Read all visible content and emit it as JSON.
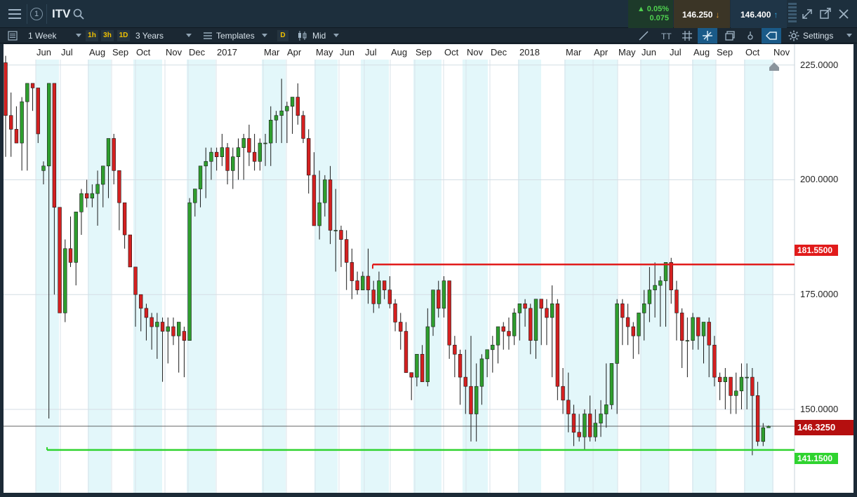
{
  "header": {
    "symbol": "ITV",
    "chart_number": "1",
    "change_pct": "0.05%",
    "change_abs": "0.075",
    "sell_price": "146.250",
    "buy_price": "146.400"
  },
  "toolbar": {
    "interval": "1 Week",
    "quick_intervals": [
      "1h",
      "3h",
      "1D"
    ],
    "range": "3 Years",
    "templates": "Templates",
    "price_type_chip": "D",
    "price_type": "Mid",
    "settings": "Settings"
  },
  "chart_data": {
    "type": "candlestick",
    "instrument": "ITV",
    "interval": "1 Week",
    "x_labels": [
      "Jun",
      "Jul",
      "Aug",
      "Sep",
      "Oct",
      "Nov",
      "Dec",
      "2017",
      "Mar",
      "Apr",
      "May",
      "Jun",
      "Jul",
      "Aug",
      "Sep",
      "Oct",
      "Nov",
      "Dec",
      "2018",
      "Mar",
      "Apr",
      "May",
      "Jun",
      "Jul",
      "Aug",
      "Sep",
      "Oct",
      "Nov"
    ],
    "y_ticks": [
      "225.0000",
      "200.0000",
      "175.0000",
      "150.0000"
    ],
    "ylim": [
      136.5,
      228
    ],
    "current_price": "146.3250",
    "horizontal_lines": [
      {
        "label": "181.5500",
        "value": 181.55,
        "color": "#e11b1b"
      },
      {
        "label": "141.1500",
        "value": 141.15,
        "color": "#2fd32f"
      }
    ],
    "colors": {
      "up": "#2e9e2e",
      "down": "#d42020",
      "band": "#e3f7fa"
    },
    "candles": [
      [
        225.5,
        227,
        205,
        214
      ],
      [
        214,
        219,
        205,
        211
      ],
      [
        211,
        216,
        208,
        208
      ],
      [
        208,
        218,
        202,
        217
      ],
      [
        217,
        221,
        202,
        221
      ],
      [
        221,
        221,
        215,
        220
      ],
      [
        220,
        220,
        208,
        210
      ],
      [
        202,
        204,
        199,
        203
      ],
      [
        203,
        220,
        148,
        221
      ],
      [
        221,
        221,
        175,
        194
      ],
      [
        194,
        194,
        171,
        171
      ],
      [
        171,
        187,
        169,
        185
      ],
      [
        185,
        192,
        181,
        182
      ],
      [
        182,
        193,
        177,
        193
      ],
      [
        193,
        198,
        188,
        197
      ],
      [
        197,
        200,
        194,
        196
      ],
      [
        196,
        199,
        194,
        197
      ],
      [
        197,
        202,
        190,
        199
      ],
      [
        199,
        202,
        194,
        203
      ],
      [
        203,
        202,
        196,
        209
      ],
      [
        209,
        210,
        199,
        202
      ],
      [
        202,
        202,
        189,
        195
      ],
      [
        195,
        194,
        185,
        188
      ],
      [
        188,
        186,
        182,
        181
      ],
      [
        181,
        180,
        168,
        175
      ],
      [
        175,
        173,
        167,
        172
      ],
      [
        172,
        173,
        165,
        170
      ],
      [
        170,
        171,
        163,
        168
      ],
      [
        168,
        171,
        161,
        169
      ],
      [
        169,
        170,
        156,
        167
      ],
      [
        167,
        170,
        160,
        168
      ],
      [
        168,
        170,
        164,
        166
      ],
      [
        166,
        169,
        158,
        169
      ],
      [
        167,
        168,
        157,
        165
      ],
      [
        165,
        196,
        165,
        195
      ],
      [
        195,
        197,
        192,
        198
      ],
      [
        198,
        202,
        194,
        203
      ],
      [
        203,
        207,
        196,
        204
      ],
      [
        204,
        207,
        200,
        206
      ],
      [
        206,
        207,
        202,
        205
      ],
      [
        205,
        210,
        203,
        207
      ],
      [
        207,
        208,
        199,
        202
      ],
      [
        202,
        207,
        198,
        205
      ],
      [
        205,
        209,
        200,
        207
      ],
      [
        207,
        210,
        200,
        209
      ],
      [
        209,
        212,
        203,
        206
      ],
      [
        206,
        210,
        202,
        204
      ],
      [
        204,
        209,
        202,
        208
      ],
      [
        208,
        210,
        203,
        208
      ],
      [
        208,
        216,
        203,
        213
      ],
      [
        213,
        215,
        208,
        214
      ],
      [
        214,
        222,
        208,
        215
      ],
      [
        215,
        217,
        208,
        216
      ],
      [
        216,
        217,
        210,
        218
      ],
      [
        218,
        221,
        212,
        214
      ],
      [
        214,
        215,
        208,
        209
      ],
      [
        209,
        211,
        197,
        201
      ],
      [
        201,
        206,
        192,
        190
      ],
      [
        190,
        202,
        187,
        195
      ],
      [
        195,
        201,
        192,
        200
      ],
      [
        200,
        203,
        186,
        189
      ],
      [
        189,
        198,
        180,
        189
      ],
      [
        189,
        190,
        181,
        187
      ],
      [
        187,
        189,
        176,
        182
      ],
      [
        182,
        185,
        174,
        178
      ],
      [
        178,
        180,
        175,
        176
      ],
      [
        176,
        180,
        177,
        179
      ],
      [
        179,
        185,
        173,
        176
      ],
      [
        176,
        178,
        171,
        173
      ],
      [
        173,
        180,
        172,
        178
      ],
      [
        178,
        178,
        174,
        176
      ],
      [
        176,
        179,
        172,
        173
      ],
      [
        173,
        174,
        167,
        169
      ],
      [
        169,
        171,
        163,
        167
      ],
      [
        167,
        169,
        158,
        158
      ],
      [
        158,
        158,
        152,
        157
      ],
      [
        157,
        160,
        155,
        162
      ],
      [
        162,
        164,
        159,
        156
      ],
      [
        156,
        172,
        155,
        168
      ],
      [
        168,
        174,
        166,
        176
      ],
      [
        176,
        178,
        170,
        172
      ],
      [
        172,
        179,
        170,
        178
      ],
      [
        178,
        178,
        161,
        164
      ],
      [
        164,
        166,
        157,
        162
      ],
      [
        162,
        163,
        151,
        157
      ],
      [
        157,
        163,
        149,
        155
      ],
      [
        155,
        166,
        143,
        149
      ],
      [
        149,
        160,
        143,
        155
      ],
      [
        155,
        162,
        151,
        161
      ],
      [
        161,
        162,
        157,
        163
      ],
      [
        163,
        166,
        158,
        164
      ],
      [
        164,
        167,
        160,
        168
      ],
      [
        168,
        169,
        163,
        167
      ],
      [
        167,
        170,
        163,
        166
      ],
      [
        166,
        172,
        164,
        171
      ],
      [
        171,
        173,
        165,
        173
      ],
      [
        173,
        174,
        168,
        172
      ],
      [
        172,
        173,
        162,
        165
      ],
      [
        165,
        174,
        161,
        174
      ],
      [
        174,
        171,
        164,
        172
      ],
      [
        172,
        174,
        164,
        170
      ],
      [
        170,
        177,
        157,
        173
      ],
      [
        173,
        174,
        152,
        155
      ],
      [
        155,
        159,
        149,
        152
      ],
      [
        152,
        158,
        145,
        149
      ],
      [
        149,
        151,
        142,
        145
      ],
      [
        145,
        149,
        143,
        144
      ],
      [
        144,
        150,
        141,
        149
      ],
      [
        149,
        153,
        143,
        144
      ],
      [
        144,
        150,
        143,
        147
      ],
      [
        147,
        152,
        144,
        149
      ],
      [
        149,
        160,
        146,
        151
      ],
      [
        151,
        152,
        150,
        160
      ],
      [
        160,
        174,
        149,
        173
      ],
      [
        173,
        174,
        164,
        170
      ],
      [
        170,
        173,
        164,
        168
      ],
      [
        168,
        169,
        161,
        166
      ],
      [
        166,
        169,
        162,
        171
      ],
      [
        171,
        176,
        165,
        173
      ],
      [
        173,
        181,
        169,
        176
      ],
      [
        176,
        182,
        170,
        177
      ],
      [
        177,
        179,
        168,
        178
      ],
      [
        178,
        181,
        168,
        182
      ],
      [
        182,
        183,
        173,
        176
      ],
      [
        176,
        178,
        165,
        171
      ],
      [
        171,
        172,
        159,
        165
      ],
      [
        165,
        170,
        157,
        165
      ],
      [
        165,
        171,
        163,
        170
      ],
      [
        170,
        170,
        163,
        166
      ],
      [
        166,
        168,
        160,
        169
      ],
      [
        169,
        170,
        157,
        164
      ],
      [
        164,
        166,
        155,
        157
      ],
      [
        157,
        158,
        152,
        156
      ],
      [
        156,
        159,
        150,
        157
      ],
      [
        157,
        157,
        149,
        153
      ],
      [
        153,
        158,
        149,
        154
      ],
      [
        154,
        160,
        150,
        157
      ],
      [
        157,
        160,
        150,
        157
      ],
      [
        157,
        159,
        140,
        153
      ],
      [
        153,
        156,
        142,
        143
      ],
      [
        143,
        147,
        142,
        146
      ],
      [
        146,
        146.5,
        146,
        146.3
      ]
    ]
  }
}
